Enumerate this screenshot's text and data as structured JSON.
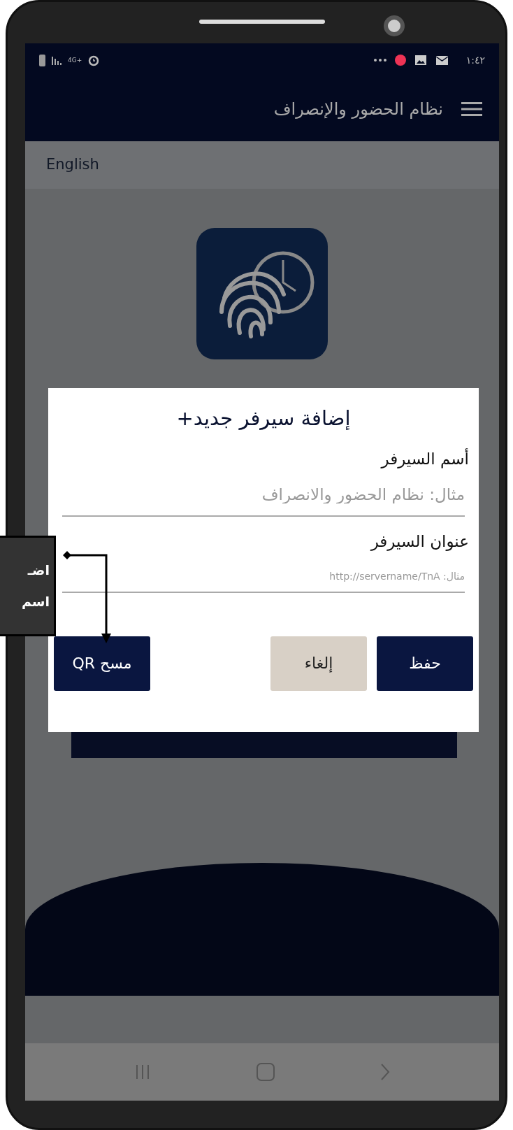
{
  "status_bar": {
    "network": "4G+",
    "time": "١:٤٢"
  },
  "app_bar": {
    "title": "نظام الحضور والإنصراف"
  },
  "language_link": "English",
  "dialog": {
    "title": "إضافة سيرفر جديد+",
    "fields": [
      {
        "label": "أسم السيرفر",
        "placeholder": "مثال: نظام الحضور والانصراف",
        "kind": "large"
      },
      {
        "label": "عنوان السيرفر",
        "placeholder": "مثال: http://servername/TnA",
        "kind": "small"
      }
    ],
    "buttons": [
      {
        "label": "حفظ",
        "kind": "primary"
      },
      {
        "label": "إلغاء",
        "kind": "secondary"
      },
      {
        "label": "مسح QR",
        "kind": "primary"
      }
    ]
  },
  "callout": {
    "lines": [
      "اضـ",
      "اسم"
    ]
  }
}
